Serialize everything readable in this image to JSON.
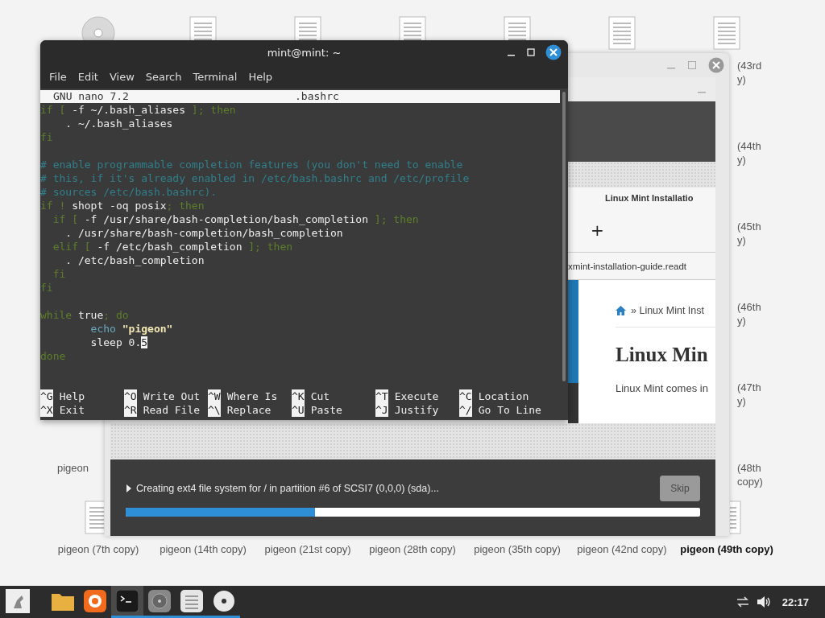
{
  "desktop": {
    "top_icons": [
      {
        "kind": "disc"
      },
      {
        "kind": "file"
      },
      {
        "kind": "file"
      },
      {
        "kind": "file"
      },
      {
        "kind": "file"
      },
      {
        "kind": "file"
      },
      {
        "kind": "file"
      }
    ],
    "left_label": "pigeon",
    "side_labels": [
      {
        "lines": [
          "(43rd",
          "y)"
        ]
      },
      {
        "lines": [
          "(44th",
          "y)"
        ]
      },
      {
        "lines": [
          "(45th",
          "y)"
        ]
      },
      {
        "lines": [
          "(46th",
          "y)"
        ]
      },
      {
        "lines": [
          "(47th",
          "y)"
        ]
      },
      {
        "lines": [
          "(48th",
          "copy)"
        ]
      }
    ],
    "bottom_icons": [
      {
        "label": "pigeon (7th copy)",
        "selected": false
      },
      {
        "label": "pigeon (14th copy)",
        "selected": false
      },
      {
        "label": "pigeon (21st copy)",
        "selected": false
      },
      {
        "label": "pigeon (28th copy)",
        "selected": false
      },
      {
        "label": "pigeon (35th copy)",
        "selected": false
      },
      {
        "label": "pigeon (42nd copy)",
        "selected": false
      },
      {
        "label": "pigeon (49th copy)",
        "selected": true
      }
    ]
  },
  "installer": {
    "browser": {
      "title": "Linux Mint Installatio",
      "new_tab": "+",
      "url": "xmint-installation-guide.readt",
      "breadcrumb": "» Linux Mint Inst",
      "heading": "Linux Min",
      "paragraph": "Linux Mint comes in"
    },
    "status": "Creating ext4 file system for / in partition #6 of SCSI7 (0,0,0) (sda)...",
    "skip_button": {
      "label": "Skip",
      "disabled": true
    },
    "progress": {
      "level": 0.33
    }
  },
  "terminal": {
    "title": "mint@mint: ~",
    "menu": [
      "File",
      "Edit",
      "View",
      "Search",
      "Terminal",
      "Help"
    ],
    "nano_version": "GNU nano 7.2",
    "filename": ".bashrc",
    "lines": [
      {
        "segments": [
          {
            "text": "if [ ",
            "kind": "keyword"
          },
          {
            "text": "-f ~/.bash_aliases ",
            "kind": "plain"
          },
          {
            "text": "]; then",
            "kind": "keyword"
          }
        ]
      },
      {
        "segments": [
          {
            "text": "    . ~/.bash_aliases",
            "kind": "plain"
          }
        ]
      },
      {
        "segments": [
          {
            "text": "fi",
            "kind": "keyword"
          }
        ]
      },
      {
        "kind": "blank"
      },
      {
        "segments": [
          {
            "text": "# enable programmable completion features (you don't need to enable",
            "kind": "comment"
          }
        ]
      },
      {
        "segments": [
          {
            "text": "# this, if it's already enabled in /etc/bash.bashrc and /etc/profile",
            "kind": "comment"
          }
        ]
      },
      {
        "segments": [
          {
            "text": "# sources /etc/bash.bashrc).",
            "kind": "comment"
          }
        ]
      },
      {
        "segments": [
          {
            "text": "if !",
            "kind": "keyword"
          },
          {
            "text": " shopt -oq posix",
            "kind": "plain"
          },
          {
            "text": "; then",
            "kind": "keyword"
          }
        ]
      },
      {
        "segments": [
          {
            "text": "  if [ ",
            "kind": "keyword"
          },
          {
            "text": "-f /usr/share/bash-completion/bash_completion ",
            "kind": "plain"
          },
          {
            "text": "]; then",
            "kind": "keyword"
          }
        ]
      },
      {
        "segments": [
          {
            "text": "    . /usr/share/bash-completion/bash_completion",
            "kind": "plain"
          }
        ]
      },
      {
        "segments": [
          {
            "text": "  elif [ ",
            "kind": "keyword"
          },
          {
            "text": "-f /etc/bash_completion ",
            "kind": "plain"
          },
          {
            "text": "]; then",
            "kind": "keyword"
          }
        ]
      },
      {
        "segments": [
          {
            "text": "    . /etc/bash_completion",
            "kind": "plain"
          }
        ]
      },
      {
        "segments": [
          {
            "text": "  fi",
            "kind": "keyword"
          }
        ]
      },
      {
        "segments": [
          {
            "text": "fi",
            "kind": "keyword"
          }
        ]
      },
      {
        "kind": "blank"
      },
      {
        "segments": [
          {
            "text": "while",
            "kind": "keyword"
          },
          {
            "text": " true",
            "kind": "plain"
          },
          {
            "text": "; do",
            "kind": "keyword"
          }
        ]
      },
      {
        "segments": [
          {
            "text": "        echo",
            "kind": "builtin"
          },
          {
            "text": " \"pigeon\"",
            "kind": "string"
          }
        ]
      },
      {
        "segments": [
          {
            "text": "        sleep 0.",
            "kind": "plain"
          },
          {
            "text": "5",
            "kind": "cursor"
          }
        ]
      },
      {
        "segments": [
          {
            "text": "done",
            "kind": "keyword"
          }
        ]
      }
    ],
    "shortcuts": [
      [
        {
          "key": "^G",
          "label": "Help"
        },
        {
          "key": "^O",
          "label": "Write Out"
        },
        {
          "key": "^W",
          "label": "Where Is"
        },
        {
          "key": "^K",
          "label": "Cut"
        },
        {
          "key": "^T",
          "label": "Execute"
        },
        {
          "key": "^C",
          "label": "Location"
        }
      ],
      [
        {
          "key": "^X",
          "label": "Exit"
        },
        {
          "key": "^R",
          "label": "Read File"
        },
        {
          "key": "^\\",
          "label": "Replace"
        },
        {
          "key": "^U",
          "label": "Paste"
        },
        {
          "key": "^J",
          "label": "Justify"
        },
        {
          "key": "^/",
          "label": "Go To Line"
        }
      ]
    ]
  },
  "taskbar": {
    "launchers": [
      {
        "kind": "folder",
        "running": false,
        "selected": false
      },
      {
        "kind": "browser",
        "running": false,
        "selected": false
      },
      {
        "kind": "terminal",
        "running": true,
        "selected": true
      },
      {
        "kind": "disk",
        "running": true,
        "selected": false
      },
      {
        "kind": "notes",
        "running": true,
        "selected": false
      },
      {
        "kind": "disc",
        "running": true,
        "selected": false
      }
    ],
    "clock": "22:17"
  }
}
